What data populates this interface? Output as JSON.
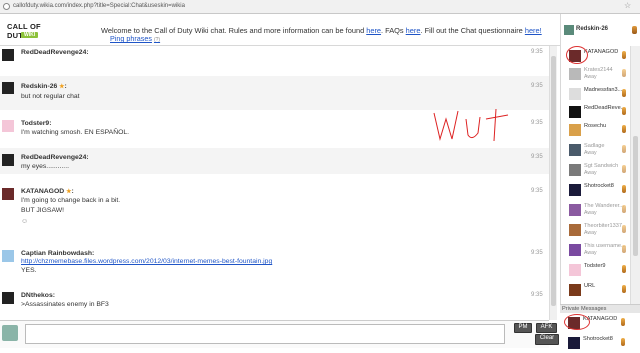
{
  "browser": {
    "url": "callofduty.wikia.com/index.php?title=Special:Chat&useskin=wikia"
  },
  "header": {
    "logo_text": "CALL OF DUTY",
    "logo_badge": "WIKI",
    "welcome_prefix": "Welcome to the Call of Duty Wiki chat. Rules and more information can be found ",
    "link_here1": "here",
    "welcome_mid": ". FAQs ",
    "link_here2": "here",
    "welcome_mid2": ". Fill out the Chat questionnaire ",
    "link_here3": "here!",
    "ping_phrases": "Ping phrases",
    "ping_help": "(?)"
  },
  "current_user": {
    "name": "Redskin-26"
  },
  "messages": [
    {
      "user": "RedDeadRevenge24:",
      "lines": [],
      "time": "9:35"
    },
    {
      "user": "Redskin-26",
      "staff": "★",
      "suffix": ":",
      "lines": [
        "but not regular chat"
      ],
      "time": "9:35"
    },
    {
      "user": "Todster9:",
      "lines": [
        "I'm watching smosh. EN ESPAÑOL."
      ],
      "time": "9:35"
    },
    {
      "user": "RedDeadRevenge24:",
      "lines": [
        "my eyes............"
      ],
      "time": "9:35"
    },
    {
      "user": "KATANAGOD",
      "staff": "★",
      "suffix": ":",
      "lines": [
        "I'm going to change back in a bit.",
        "BUT JIGSAW!"
      ],
      "time": "9:35"
    },
    {
      "user": "Captian Rainbowdash:",
      "link": "http://chzmemebase.files.wordpress.com/2012/03/internet-memes-best-fountain.jpg",
      "lines": [
        "YES."
      ],
      "time": "9:35"
    },
    {
      "user": "DNthekos:",
      "lines": [
        ">Assassinates enemy in BF3"
      ],
      "time": "9:35"
    }
  ],
  "users": [
    {
      "name": "KATANAGOD",
      "away": false
    },
    {
      "name": "Krates2144",
      "status": "Away",
      "away": true
    },
    {
      "name": "Madnessfan3...",
      "away": false
    },
    {
      "name": "RedDeadReve...",
      "away": false
    },
    {
      "name": "Rosechu",
      "away": false
    },
    {
      "name": "Sadlage",
      "status": "Away",
      "away": true
    },
    {
      "name": "Sgt Sandwich",
      "status": "Away",
      "away": true
    },
    {
      "name": "Shotrocket8",
      "away": false
    },
    {
      "name": "The Wanderer...",
      "status": "Away",
      "away": true
    },
    {
      "name": "Theorbiter1337",
      "status": "Away",
      "away": true
    },
    {
      "name": "This username...",
      "status": "Away",
      "away": true
    },
    {
      "name": "Todster9",
      "away": false
    },
    {
      "name": "URL",
      "away": false
    }
  ],
  "private_messages": {
    "heading": "Private Messages",
    "users": [
      {
        "name": "KATANAGOD",
        "away": false
      },
      {
        "name": "Shotrocket8",
        "away": false
      }
    ]
  },
  "input": {
    "pm_label": "PM",
    "afk_label": "AFK",
    "clear_label": "Clear"
  },
  "colors": {
    "link": "#1f55c7",
    "staff_star": "#f0a01e",
    "annotation": "#dd2222"
  }
}
